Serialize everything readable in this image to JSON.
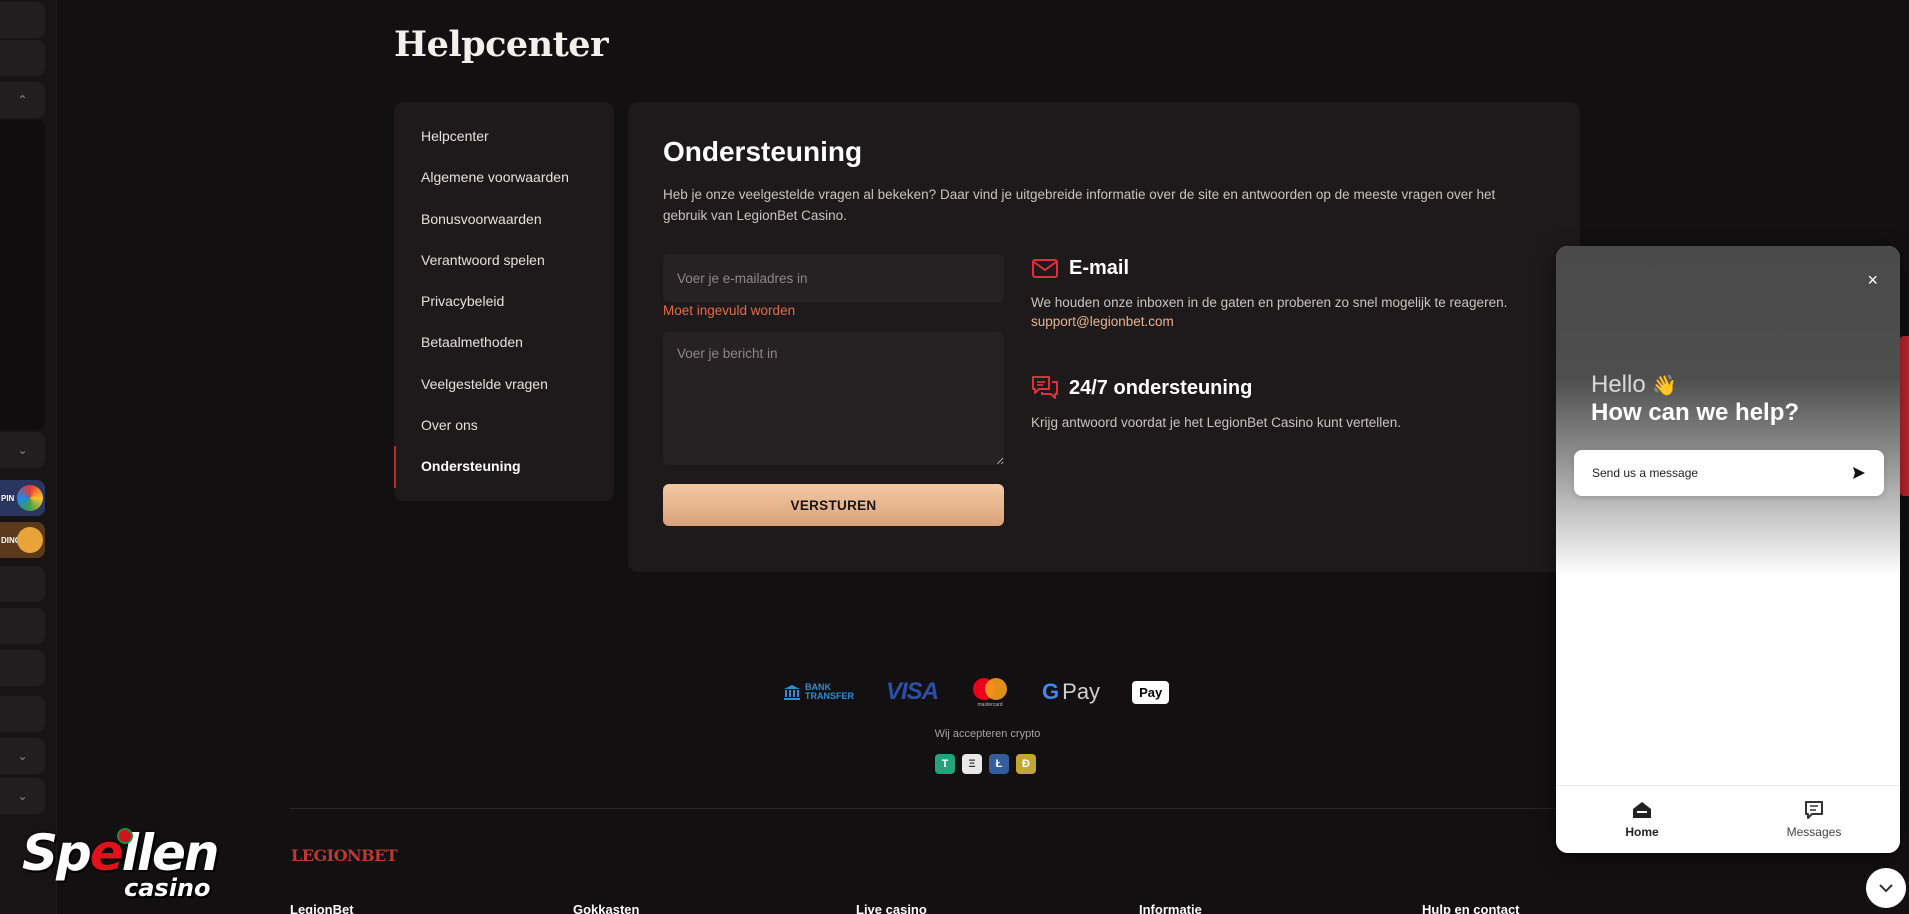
{
  "page": {
    "title": "Helpcenter"
  },
  "sidebar": {
    "items": [
      {
        "label": "Helpcenter"
      },
      {
        "label": "Algemene voorwaarden"
      },
      {
        "label": "Bonusvoorwaarden"
      },
      {
        "label": "Verantwoord spelen"
      },
      {
        "label": "Privacybeleid"
      },
      {
        "label": "Betaalmethoden"
      },
      {
        "label": "Veelgestelde vragen"
      },
      {
        "label": "Over ons"
      },
      {
        "label": "Ondersteuning"
      }
    ],
    "active_label": "Ondersteuning"
  },
  "support": {
    "title": "Ondersteuning",
    "description": "Heb je onze veelgestelde vragen al bekeken? Daar vind je uitgebreide informatie over de site en antwoorden op de meeste vragen over het gebruik van LegionBet Casino.",
    "email_placeholder": "Voer je e-mailadres in",
    "email_error": "Moet ingevuld worden",
    "message_placeholder": "Voer je bericht in",
    "submit_label": "VERSTUREN"
  },
  "contact": {
    "email": {
      "title": "E-mail",
      "text": "We houden onze inboxen in de gaten en proberen zo snel mogelijk te reageren.",
      "address": "support@legionbet.com",
      "icon": "mail-icon"
    },
    "support247": {
      "title": "24/7 ondersteuning",
      "text": "Krijg antwoord voordat je het LegionBet Casino kunt vertellen.",
      "icon": "chat-bubbles-icon"
    }
  },
  "payments": {
    "bank_line1": "BANK",
    "bank_line2": "TRANSFER",
    "visa": "VISA",
    "mastercard": "mastercard",
    "gpay": "Pay",
    "applepay": "Pay",
    "crypto_note": "Wij accepteren crypto",
    "crypto": [
      "T",
      "Ξ",
      "Ł",
      "Ð"
    ]
  },
  "footer": {
    "logo": "LEGIONBET",
    "columns": [
      "LegionBet",
      "Gokkasten",
      "Live casino",
      "Informatie",
      "Hulp en contact"
    ]
  },
  "rail": {
    "game1": "PIN",
    "game2": "DING"
  },
  "watermark": {
    "big_a": "Sp",
    "big_red": "e",
    "big_b": "llen",
    "small": "casino"
  },
  "chat": {
    "hello": "Hello",
    "wave": "👋",
    "help": "How can we help?",
    "send_label": "Send us a message",
    "close": "×",
    "tabs": [
      {
        "label": "Home"
      },
      {
        "label": "Messages"
      }
    ]
  },
  "colors": {
    "accent_red": "#c1272d",
    "button_gold": "#e8b48e",
    "panel_bg": "#1e1a1b",
    "page_bg": "#121011"
  }
}
